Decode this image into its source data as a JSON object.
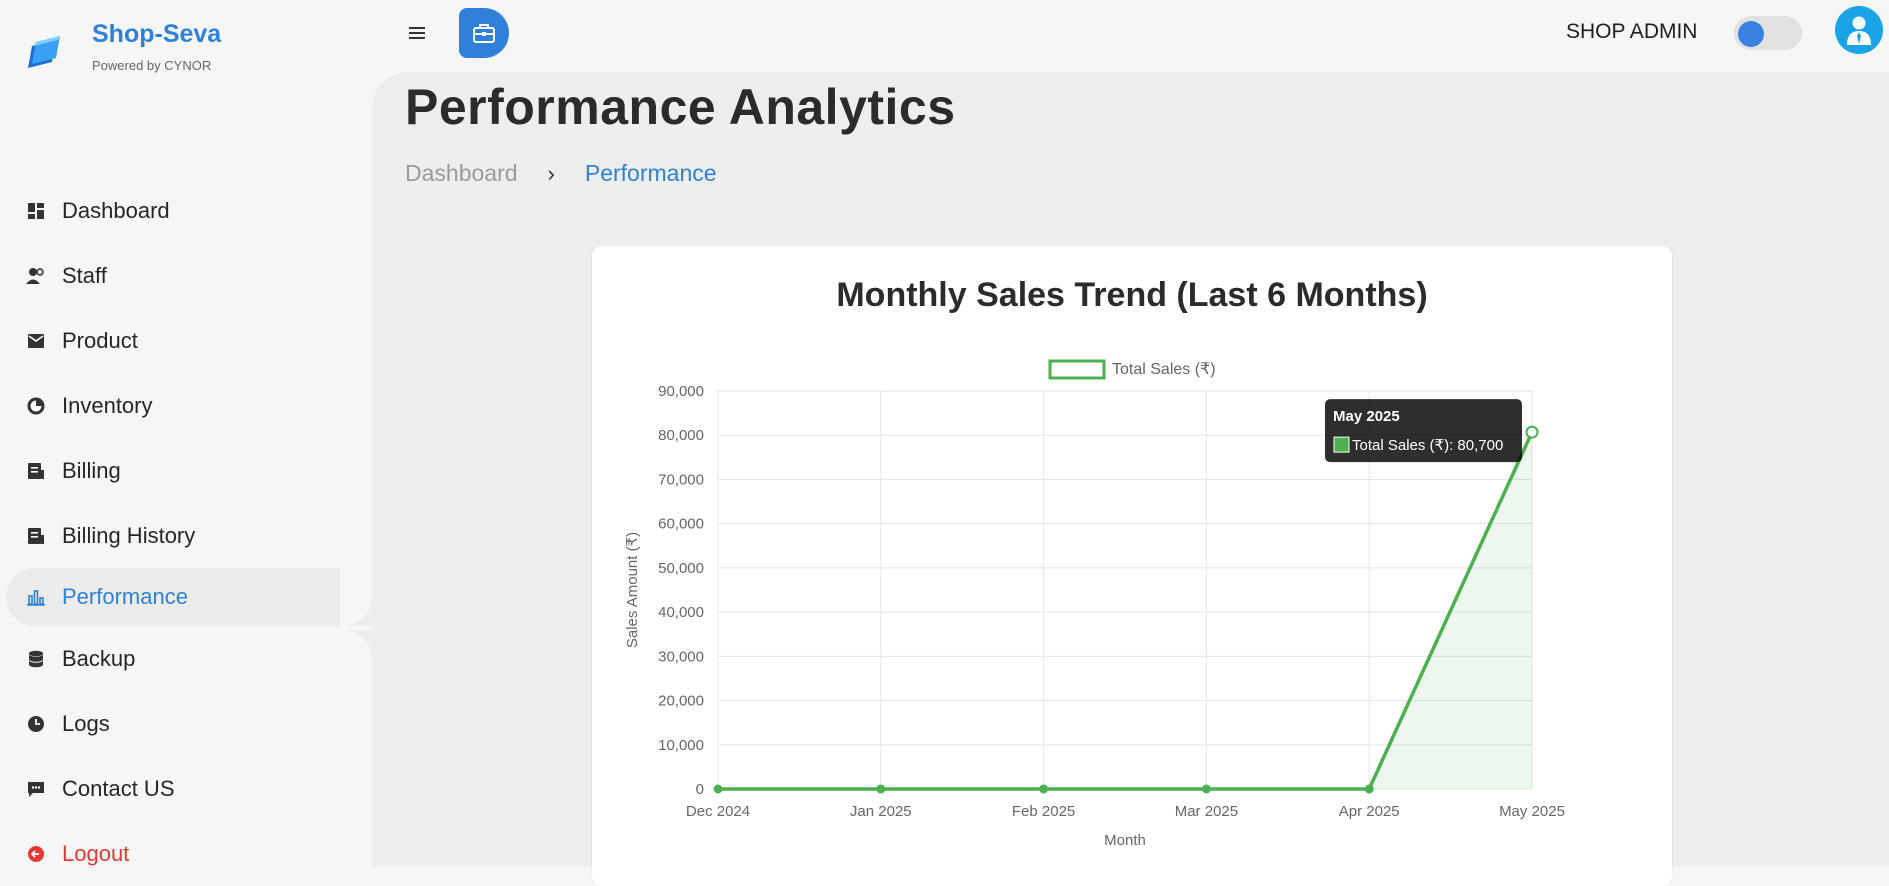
{
  "brand": {
    "name": "Shop-Seva",
    "sub": "Powered by CYNOR"
  },
  "topbar": {
    "role": "SHOP ADMIN"
  },
  "sidebar": {
    "items": [
      {
        "label": "Dashboard",
        "icon": "dashboard-icon"
      },
      {
        "label": "Staff",
        "icon": "staff-icon"
      },
      {
        "label": "Product",
        "icon": "product-icon"
      },
      {
        "label": "Inventory",
        "icon": "inventory-icon"
      },
      {
        "label": "Billing",
        "icon": "billing-icon"
      },
      {
        "label": "Billing History",
        "icon": "billing-history-icon"
      },
      {
        "label": "Performance",
        "icon": "performance-icon",
        "active": true
      },
      {
        "label": "Backup",
        "icon": "backup-icon"
      },
      {
        "label": "Logs",
        "icon": "logs-icon"
      },
      {
        "label": "Contact US",
        "icon": "contact-icon"
      },
      {
        "label": "Logout",
        "icon": "logout-icon"
      }
    ]
  },
  "page": {
    "title": "Performance Analytics",
    "breadcrumb": {
      "home": "Dashboard",
      "separator": "›",
      "current": "Performance"
    }
  },
  "colors": {
    "accent": "#2f80d8",
    "series": "#4caf50",
    "logout": "#e53935"
  },
  "chart_data": {
    "type": "line",
    "title": "Monthly Sales Trend (Last 6 Months)",
    "xlabel": "Month",
    "ylabel": "Sales Amount (₹)",
    "categories": [
      "Dec 2024",
      "Jan 2025",
      "Feb 2025",
      "Mar 2025",
      "Apr 2025",
      "May 2025"
    ],
    "series": [
      {
        "name": "Total Sales (₹)",
        "values": [
          0,
          0,
          0,
          0,
          0,
          80700
        ]
      }
    ],
    "ylim": [
      0,
      90000
    ],
    "yticks": [
      "0",
      "10,000",
      "20,000",
      "30,000",
      "40,000",
      "50,000",
      "60,000",
      "70,000",
      "80,000",
      "90,000"
    ],
    "grid": true,
    "legend": "top",
    "tooltip": {
      "title": "May 2025",
      "text": "Total Sales (₹): 80,700"
    }
  }
}
